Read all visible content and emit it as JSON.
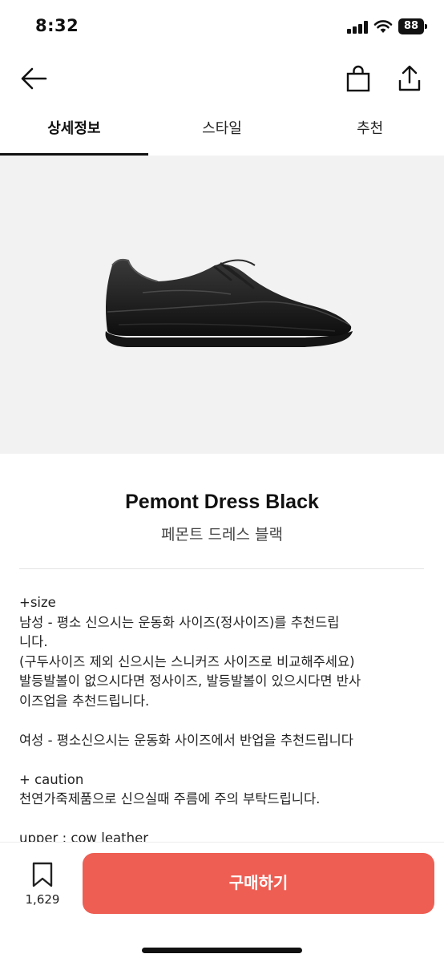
{
  "status_bar": {
    "time": "8:32",
    "battery": "88",
    "icons": [
      "signal-icon",
      "wifi-icon",
      "battery-icon"
    ]
  },
  "app_bar": {
    "icons": [
      "back-arrow-icon",
      "shopping-bag-icon",
      "share-icon"
    ]
  },
  "tabs": [
    {
      "label": "상세정보",
      "active": true
    },
    {
      "label": "스타일",
      "active": false
    },
    {
      "label": "추천",
      "active": false
    }
  ],
  "product": {
    "name": "Pemont Dress Black",
    "name_kr": "페몬트 드레스 블랙"
  },
  "description": {
    "size_heading": "+size",
    "men": "남성 - 평소 신으시는 운동화 사이즈(정사이즈)를 추천드립\n니다.\n(구두사이즈 제외 신으시는 스니커즈 사이즈로 비교해주세요)\n발등발볼이 없으시다면 정사이즈, 발등발볼이 있으시다면 반사\n이즈업을 추천드립니다.",
    "women": "여성 - 평소신으시는 운동화 사이즈에서 반업을 추천드립니다",
    "caution_heading": "+ caution",
    "caution": "천연가죽제품으로 신으실때 주름에 주의 부탁드립니다.",
    "upper": "upper : cow leather"
  },
  "bottom_bar": {
    "wish_count": "1,629",
    "buy_label": "구매하기",
    "buy_color": "#ee5e53"
  }
}
